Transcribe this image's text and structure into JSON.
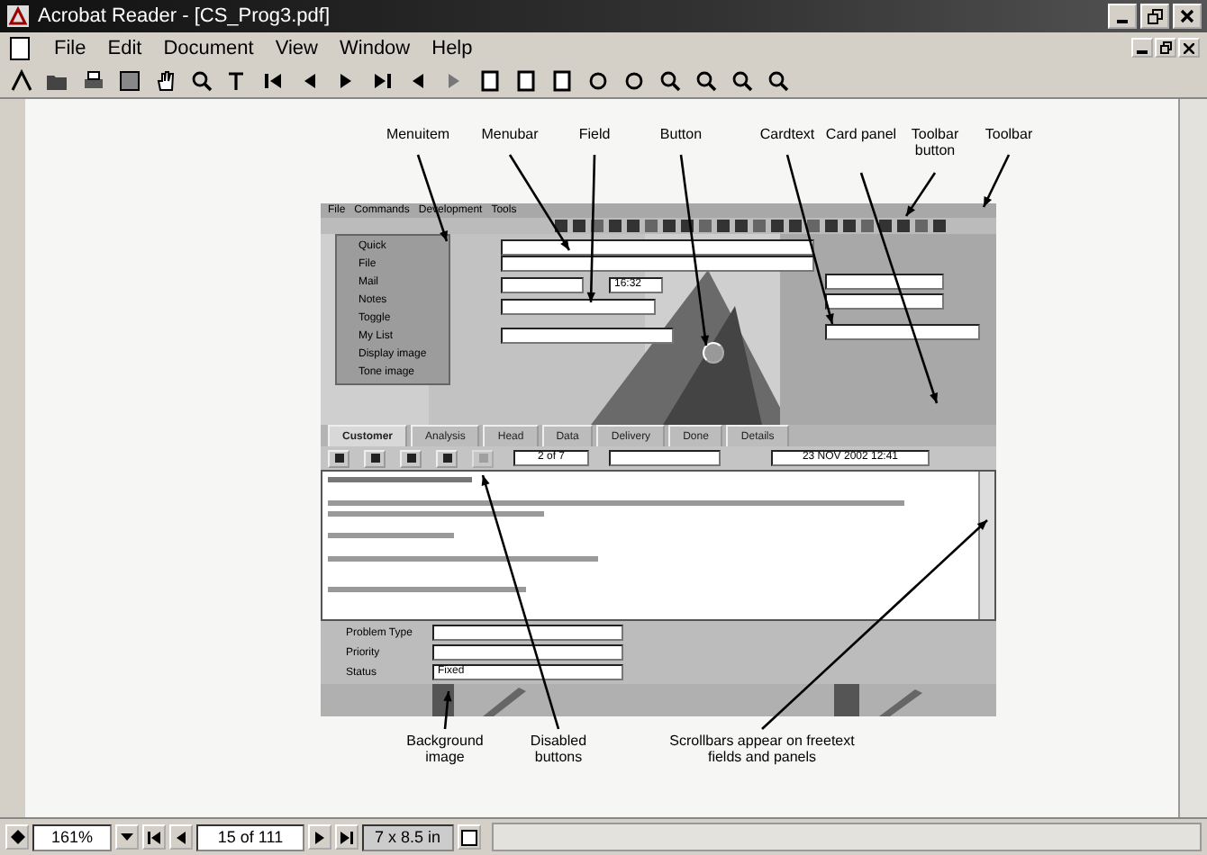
{
  "window": {
    "title": "Acrobat Reader - [CS_Prog3.pdf]"
  },
  "menu": [
    "File",
    "Edit",
    "Document",
    "View",
    "Window",
    "Help"
  ],
  "callouts_top": [
    "Menuitem",
    "Menubar",
    "Field",
    "Button",
    "Cardtext",
    "Card panel",
    "Toolbar button",
    "Toolbar"
  ],
  "callouts_bottom": [
    "Background image",
    "Disabled buttons",
    "Scrollbars appear on freetext fields and panels"
  ],
  "app": {
    "menu": [
      "File",
      "Commands",
      "Development",
      "Tools"
    ],
    "side_menu": [
      "Quick",
      "File",
      "Mail",
      "Notes",
      "Toggle",
      "My List",
      "Display image",
      "Tone image"
    ],
    "tabs": [
      {
        "label": "Customer",
        "selected": true
      },
      {
        "label": "Analysis",
        "selected": false
      },
      {
        "label": "Head",
        "selected": false
      },
      {
        "label": "Data",
        "selected": false
      },
      {
        "label": "Delivery",
        "selected": false
      },
      {
        "label": "Done",
        "selected": false
      },
      {
        "label": "Details",
        "selected": false
      }
    ],
    "time": "16:32",
    "record": "2 of 7",
    "date": "23 NOV 2002 12:41",
    "bottom_fields": [
      {
        "label": "Problem Type"
      },
      {
        "label": "Priority"
      },
      {
        "label": "Status",
        "value": "Fixed"
      }
    ]
  },
  "status_bar": {
    "zoom": "161%",
    "page": "15 of 111",
    "size": "7 x 8.5 in"
  }
}
